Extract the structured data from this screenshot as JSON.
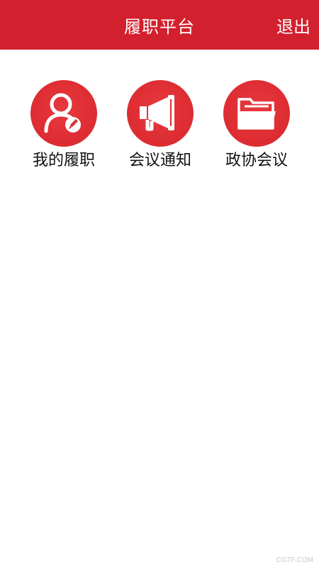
{
  "header": {
    "title": "履职平台",
    "logout_label": "退出"
  },
  "tiles": [
    {
      "label": "我的履职",
      "icon": "user-edit-icon"
    },
    {
      "label": "会议通知",
      "icon": "megaphone-icon"
    },
    {
      "label": "政协会议",
      "icon": "folder-icon"
    }
  ],
  "watermark": "CGTF.COM",
  "colors": {
    "header_bg": "#d3202e",
    "icon_circle": "#dc2c32",
    "icon_glyph": "#ffffff"
  }
}
